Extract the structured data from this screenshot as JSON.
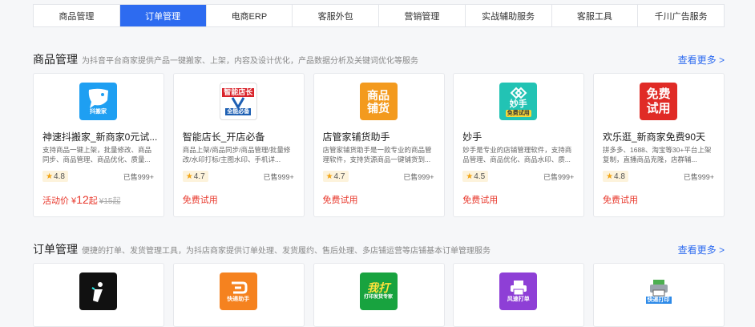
{
  "tabs": [
    {
      "label": "商品管理",
      "active": false
    },
    {
      "label": "订单管理",
      "active": true
    },
    {
      "label": "电商ERP",
      "active": false
    },
    {
      "label": "客服外包",
      "active": false
    },
    {
      "label": "营销管理",
      "active": false
    },
    {
      "label": "实战辅助服务",
      "active": false
    },
    {
      "label": "客服工具",
      "active": false
    },
    {
      "label": "千川广告服务",
      "active": false
    }
  ],
  "sections": [
    {
      "title": "商品管理",
      "desc": "为抖音平台商家提供产品一键搬家、上架，内容及设计优化，产品数据分析及关键词优化等服务",
      "more": "查看更多 >",
      "cards": [
        {
          "name": "神速抖搬家_新商家0元试...",
          "desc": "支持商品一键上架，批量修改、商品同步、商品管理、商品优化、质量...",
          "rating": "4.8",
          "sold": "已售999+",
          "price_prefix": "活动价 ¥",
          "price_num": "12",
          "price_suffix": "起",
          "price_old": "¥15起",
          "logo_big": "",
          "logo_small": "抖搬家",
          "logo_color": "#1e9ff2",
          "icon": "bird-icon"
        },
        {
          "name": "智能店长_开店必备",
          "desc": "商品上架/商品同步/商品管理/批量修改/水印打标/主图水印、手机详...",
          "rating": "4.7",
          "sold": "已售999+",
          "price_prefix": "免费试用",
          "price_num": "",
          "price_suffix": "",
          "price_old": "",
          "logo_big": "智能店长",
          "logo_small": "全能必备",
          "logo_color": "#ffffff",
          "icon": "shop-manager-icon"
        },
        {
          "name": "店管家铺货助手",
          "desc": "店管家铺货助手是一款专业的商品管理软件，支持货源商品一键铺货到...",
          "rating": "4.7",
          "sold": "已售999+",
          "price_prefix": "免费试用",
          "price_num": "",
          "price_suffix": "",
          "price_old": "",
          "logo_big": "商品\n铺货",
          "logo_small": "",
          "logo_color": "#f39a1e",
          "icon": "goods-icon"
        },
        {
          "name": "妙手",
          "desc": "妙手是专业的店铺管理软件，支持商品管理、商品优化、商品水印、质...",
          "rating": "4.5",
          "sold": "已售999+",
          "price_prefix": "免费试用",
          "price_num": "",
          "price_suffix": "",
          "price_old": "",
          "logo_big": "妙手",
          "logo_small": "免费试用",
          "logo_color": "#22c3b4",
          "icon": "miaoshou-icon"
        },
        {
          "name": "欢乐逛_新商家免费90天",
          "desc": "拼多多、1688、淘宝等30+平台上架复制，直播商品克隆，店群辅...",
          "rating": "4.8",
          "sold": "已售999+",
          "price_prefix": "免费试用",
          "price_num": "",
          "price_suffix": "",
          "price_old": "",
          "logo_big": "免费\n试用",
          "logo_small": "",
          "logo_color": "#e02b26",
          "icon": "free-trial-icon"
        }
      ]
    },
    {
      "title": "订单管理",
      "desc": "便捷的打单、发货管理工具，为抖店商家提供订单处理、发货履约、售后处理、多店铺运营等店铺基本订单管理服务",
      "more": "查看更多 >",
      "cards": [
        {
          "logo_big": "",
          "logo_small": "",
          "logo_color": "#111111",
          "icon": "tiktok-order-icon"
        },
        {
          "logo_big": "",
          "logo_small": "快递助手",
          "logo_color": "#f5821f",
          "icon": "express-helper-icon"
        },
        {
          "logo_big": "我打",
          "logo_small": "打印发货专家",
          "logo_color": "#18a33f",
          "icon": "wo-da-icon"
        },
        {
          "logo_big": "",
          "logo_small": "风速打单",
          "logo_color": "#8e3fd6",
          "icon": "printer-icon"
        },
        {
          "logo_big": "",
          "logo_small": "快递打印",
          "logo_color": "#ffffff",
          "icon": "express-print-icon"
        }
      ]
    }
  ]
}
